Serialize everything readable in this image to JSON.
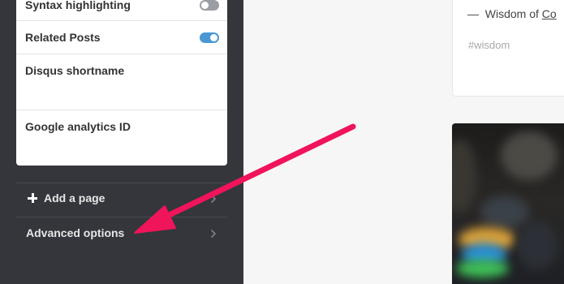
{
  "settings": {
    "syntax_highlighting_label": "Syntax highlighting",
    "syntax_highlighting_enabled": false,
    "related_posts_label": "Related Posts",
    "related_posts_enabled": true,
    "disqus_label": "Disqus shortname",
    "disqus_value": "",
    "analytics_label": "Google analytics ID",
    "analytics_value": ""
  },
  "sidebar": {
    "add_page_label": "Add a page",
    "advanced_options_label": "Advanced options"
  },
  "post": {
    "quote_dash": "—",
    "quote_prefix": "Wisdom of",
    "quote_link": "Co",
    "tag": "#wisdom"
  },
  "colors": {
    "sidebar_bg": "#34363c",
    "toggle_on": "#4a98d3",
    "toggle_off": "#9a9ea4",
    "annotation_arrow": "#f0145a"
  },
  "icons": {
    "plus": "plus-icon",
    "chevron": "chevron-right-icon",
    "arrow": "annotation-arrow-icon"
  }
}
